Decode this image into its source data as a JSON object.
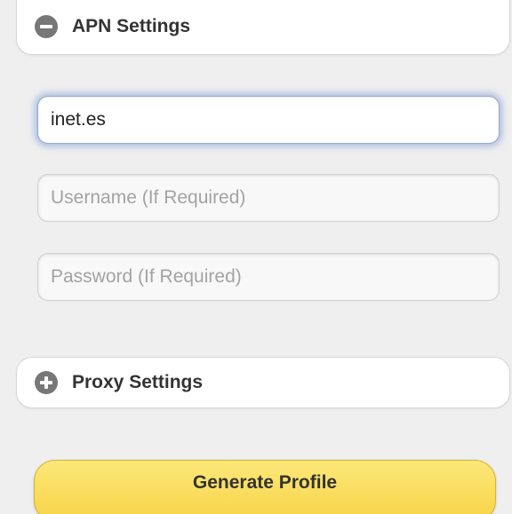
{
  "apn_section": {
    "title": "APN Settings",
    "icon": "minus-circle-icon",
    "apn_field": {
      "value": "inet.es",
      "focused": true
    },
    "username_field": {
      "value": "",
      "placeholder": "Username (If Required)"
    },
    "password_field": {
      "value": "",
      "placeholder": "Password (If Required)"
    }
  },
  "proxy_section": {
    "title": "Proxy Settings",
    "icon": "plus-circle-icon"
  },
  "generate_button": {
    "label": "Generate Profile"
  },
  "colors": {
    "page_background": "#efefef",
    "focus_glow": "#7092d2",
    "button_yellow": "#f7d347",
    "icon_gray": "#777777"
  }
}
